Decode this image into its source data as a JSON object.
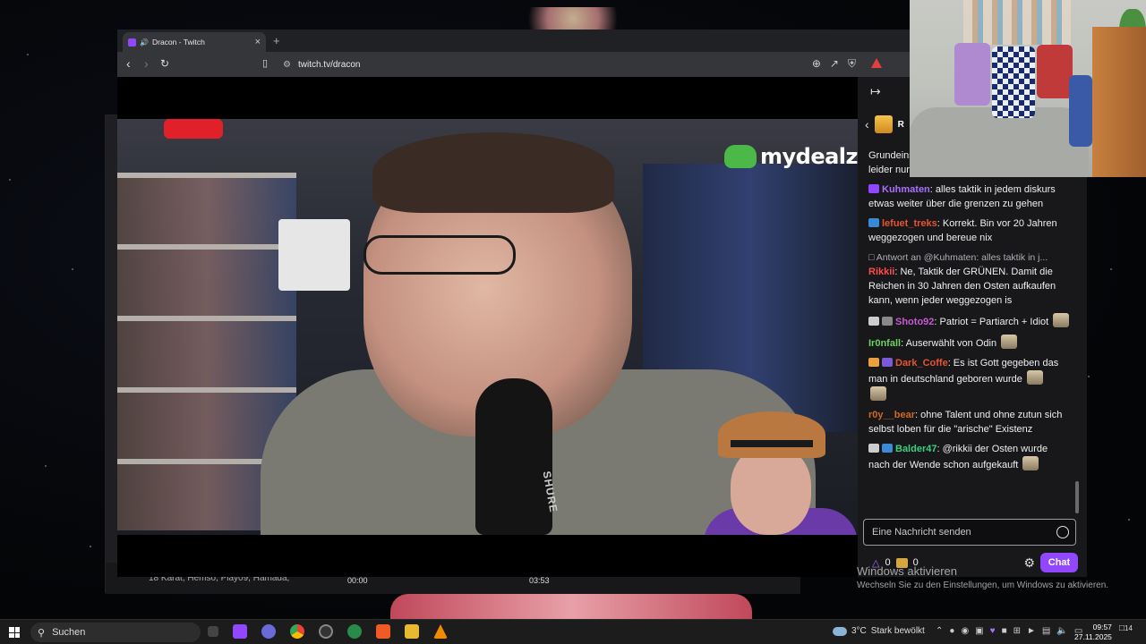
{
  "browser": {
    "tab_title": "Dracon - Twitch",
    "tab_close": "×",
    "new_tab": "+",
    "url": "twitch.tv/dracon",
    "notification_count": "1"
  },
  "video": {
    "sponsor_logo_text": "mydealz",
    "mic_brand": "SHURE"
  },
  "player_bar": {
    "time_current": "00:00",
    "time_total": "03:53",
    "supporters_text": "18 Karat, Hemso, Play09, Hamada,"
  },
  "chat": {
    "gift_label": "R",
    "messages": [
      {
        "user": "",
        "text": "Grundeins… verwurze… weitergetragen, gibt leider nur wenige die es da raus schaffen",
        "color": "#efeff1"
      },
      {
        "user": "Kuhmaten",
        "text": ": alles taktik in jedem diskurs etwas weiter über die grenzen zu gehen",
        "color": "#a970ff"
      },
      {
        "user": "lefuet_treks",
        "text": ": Korrekt. Bin vor 20 Jahren weggezogen und bereue nix",
        "color": "#e8542f"
      },
      {
        "reply": "Antwort an @Kuhmaten: alles taktik in j...",
        "user": "Rikkii",
        "text": ": Ne, Taktik der GRÜNEN. Damit die Reichen in 30 Jahren den Osten aufkaufen kann, wenn jeder weggezogen is",
        "color": "#ff4a4a"
      },
      {
        "user": "Shoto92",
        "text": ": Patriot = Partiarch + Idiot",
        "color": "#c85ad0"
      },
      {
        "user": "Ir0nfall",
        "text": ": Auserwählt von Odin",
        "color": "#6ad060"
      },
      {
        "user": "Dark_Coffe",
        "text": ": Es ist Gott gegeben das man in deutschland geboren wurde",
        "color": "#e8542f"
      },
      {
        "user": "r0y__bear",
        "text": ": ohne Talent und ohne zutun sich selbst loben für die \"arische\" Existenz",
        "color": "#d2691e"
      },
      {
        "user": "Balder47",
        "text": ": @rikkii der Osten wurde nach der Wende schon aufgekauft",
        "color": "#3ad080"
      }
    ],
    "input_placeholder": "Eine Nachricht senden",
    "points_1": "0",
    "points_2": "0",
    "chat_button": "Chat"
  },
  "watermark": {
    "line1": "Windows aktivieren",
    "line2": "Wechseln Sie zu den Einstellungen, um Windows zu aktivieren."
  },
  "taskbar": {
    "search_label": "Suchen",
    "weather_temp": "3°C",
    "weather_text": "Stark bewölkt",
    "time": "09:57",
    "date": "27.11.2025",
    "notifications": "14"
  }
}
